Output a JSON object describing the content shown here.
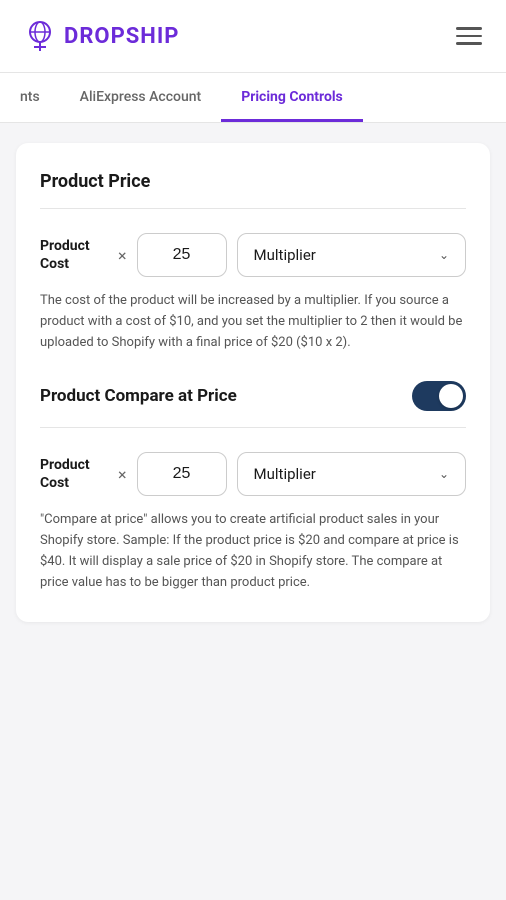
{
  "header": {
    "logo_text": "ROPSHIP",
    "logo_prefix": "D"
  },
  "tabs": {
    "items": [
      {
        "label": "nts",
        "active": false
      },
      {
        "label": "AliExpress Account",
        "active": false
      },
      {
        "label": "Pricing Controls",
        "active": true
      }
    ]
  },
  "product_price_section": {
    "title": "Product Price",
    "row": {
      "label_line1": "Product",
      "label_line2": "Cost",
      "multiply_symbol": "×",
      "input_value": "25",
      "multiplier_label": "Multiplier"
    },
    "description": "The cost of the product will be increased by a multiplier. If you source a product with a cost of $10, and you set the multiplier to 2 then it would be uploaded to Shopify with a final price of $20 ($10 x 2)."
  },
  "compare_price_section": {
    "title": "Product Compare at Price",
    "toggle_on": true,
    "row": {
      "label_line1": "Product",
      "label_line2": "Cost",
      "multiply_symbol": "×",
      "input_value": "25",
      "multiplier_label": "Multiplier"
    },
    "description": "\"Compare at price\" allows you to create artificial product sales in your Shopify store. Sample: If the product price is $20 and compare at price is $40. It will display a sale price of $20 in Shopify store. The compare at price value has to be bigger than product price."
  },
  "icons": {
    "chevron_down": "⌄",
    "multiply": "×"
  }
}
